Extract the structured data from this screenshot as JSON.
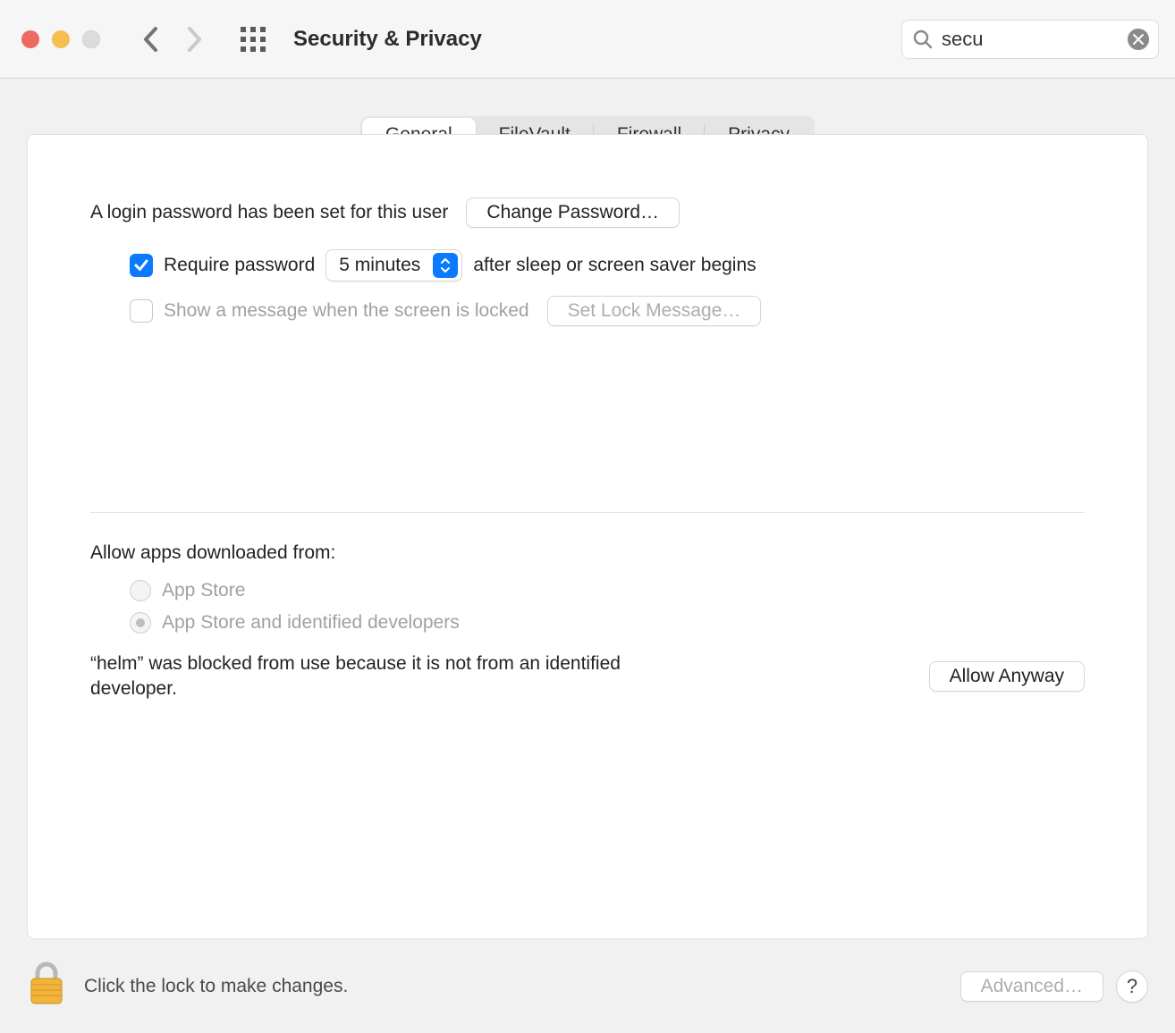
{
  "window": {
    "title": "Security & Privacy"
  },
  "search": {
    "value": "secu"
  },
  "tabs": {
    "items": [
      "General",
      "FileVault",
      "Firewall",
      "Privacy"
    ],
    "active_index": 0
  },
  "general": {
    "login_password_text": "A login password has been set for this user",
    "change_password_label": "Change Password…",
    "require_password_checked": true,
    "require_password_label": "Require password",
    "require_password_delay": "5 minutes",
    "require_password_suffix": "after sleep or screen saver begins",
    "show_message_checked": false,
    "show_message_label": "Show a message when the screen is locked",
    "set_lock_message_label": "Set Lock Message…"
  },
  "gatekeeper": {
    "section_title": "Allow apps downloaded from:",
    "options": [
      {
        "label": "App Store",
        "selected": false
      },
      {
        "label": "App Store and identified developers",
        "selected": true
      }
    ],
    "blocked_message": "“helm” was blocked from use because it is not from an identified developer.",
    "allow_anyway_label": "Allow Anyway"
  },
  "footer": {
    "lock_text": "Click the lock to make changes.",
    "advanced_label": "Advanced…",
    "help_label": "?"
  }
}
